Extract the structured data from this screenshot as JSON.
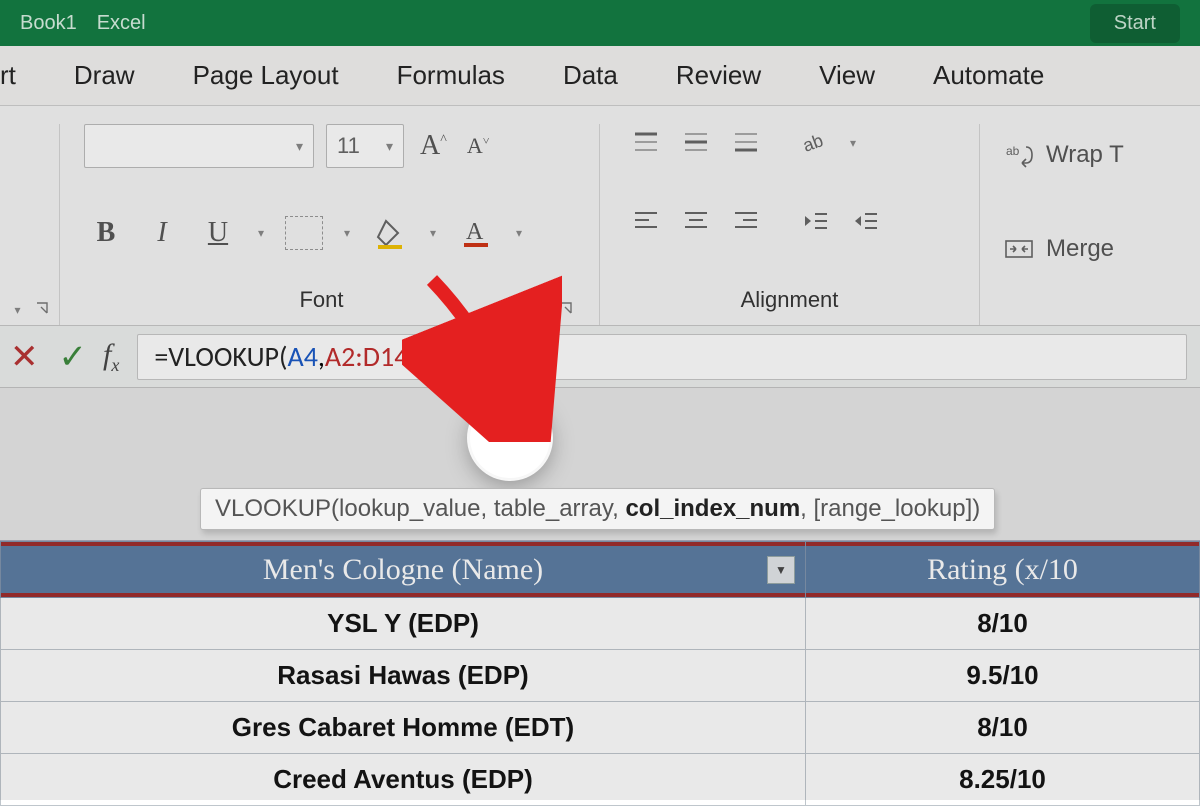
{
  "titlebar": {
    "book": "Book1",
    "app": "Excel",
    "right_button": "Start"
  },
  "tabs": [
    "rt",
    "Draw",
    "Page Layout",
    "Formulas",
    "Data",
    "Review",
    "View",
    "Automate"
  ],
  "ribbon": {
    "font_size": "11",
    "increase_label": "A^",
    "decrease_label": "A˅",
    "group_font": "Font",
    "group_align": "Alignment",
    "wrap_label": "Wrap T",
    "merge_label": "Merge"
  },
  "formula": {
    "prefix": "=",
    "fn": "VLOOKUP(",
    "ref1": "A4",
    "sep1": ",",
    "ref2": "A2:D14",
    "sep2": ","
  },
  "tooltip": {
    "fn": "VLOOKUP",
    "args_before": "(lookup_value, table_array, ",
    "arg_bold": "col_index_num",
    "args_after": ", [range_lookup])"
  },
  "table": {
    "headers": [
      "Men's Cologne (Name)",
      "Rating (x/10"
    ],
    "rows": [
      {
        "name": "YSL Y (EDP)",
        "rating": "8/10"
      },
      {
        "name": "Rasasi Hawas (EDP)",
        "rating": "9.5/10"
      },
      {
        "name": "Gres Cabaret Homme (EDT)",
        "rating": "8/10"
      },
      {
        "name": "Creed Aventus (EDP)",
        "rating": "8.25/10"
      }
    ]
  }
}
